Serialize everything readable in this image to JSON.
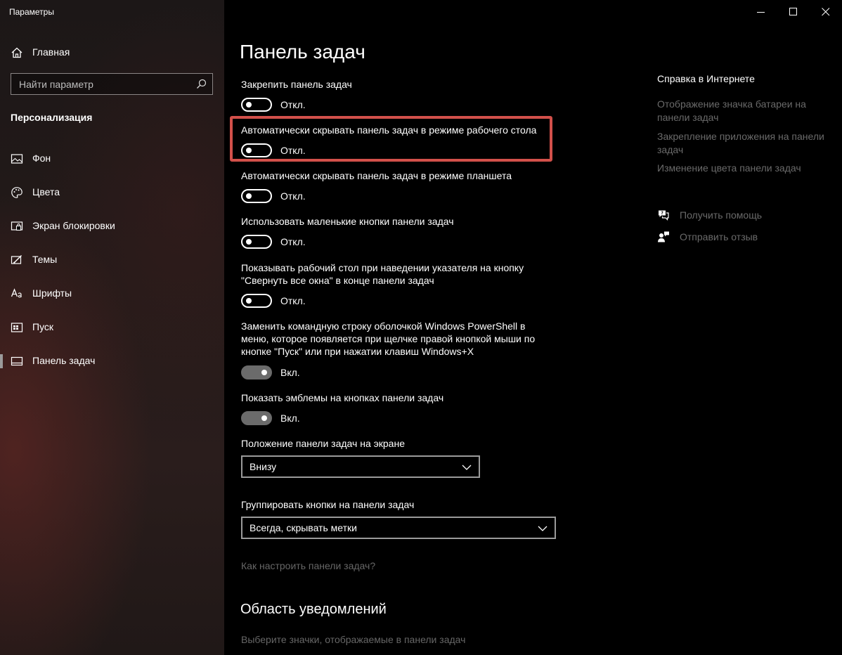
{
  "app": {
    "title": "Параметры"
  },
  "sidebar": {
    "home_label": "Главная",
    "search_placeholder": "Найти параметр",
    "section_title": "Персонализация",
    "items": [
      {
        "label": "Фон",
        "icon": "picture-icon"
      },
      {
        "label": "Цвета",
        "icon": "palette-icon"
      },
      {
        "label": "Экран блокировки",
        "icon": "lock-screen-icon"
      },
      {
        "label": "Темы",
        "icon": "themes-icon"
      },
      {
        "label": "Шрифты",
        "icon": "fonts-icon"
      },
      {
        "label": "Пуск",
        "icon": "start-icon"
      },
      {
        "label": "Панель задач",
        "icon": "taskbar-icon",
        "selected": true
      }
    ]
  },
  "main": {
    "title": "Панель задач",
    "settings": [
      {
        "label": "Закрепить панель задач",
        "state": "Откл.",
        "on": false
      },
      {
        "label": "Автоматически скрывать панель задач в режиме рабочего стола",
        "state": "Откл.",
        "on": false,
        "highlighted": true
      },
      {
        "label": "Автоматически скрывать панель задач в режиме планшета",
        "state": "Откл.",
        "on": false
      },
      {
        "label": "Использовать маленькие кнопки панели задач",
        "state": "Откл.",
        "on": false
      },
      {
        "label_lines": [
          "Показывать рабочий стол при наведении указателя на кнопку",
          "\"Свернуть все окна\" в конце панели задач"
        ],
        "state": "Откл.",
        "on": false
      },
      {
        "label_lines": [
          "Заменить командную строку оболочкой Windows PowerShell в",
          "меню, которое появляется при щелчке правой кнопкой мыши по",
          "кнопке \"Пуск\" или при нажатии клавиш Windows+X"
        ],
        "state": "Вкл.",
        "on": true
      },
      {
        "label": "Показать эмблемы на кнопках панели задач",
        "state": "Вкл.",
        "on": true
      }
    ],
    "position": {
      "label": "Положение панели задач на экране",
      "value": "Внизу"
    },
    "grouping": {
      "label": "Группировать кнопки на панели задач",
      "value": "Всегда, скрывать метки"
    },
    "how_to_link": "Как настроить панели задач?",
    "notifications_header": "Область уведомлений",
    "notifications_link": "Выберите значки, отображаемые в панели задач"
  },
  "help": {
    "title": "Справка в Интернете",
    "links": [
      [
        "Отображение значка батареи на",
        "панели задач"
      ],
      [
        "Закрепление приложения на панели",
        "задач"
      ],
      [
        "Изменение цвета панели задач"
      ]
    ],
    "get_help": "Получить помощь",
    "feedback": "Отправить отзыв"
  },
  "colors": {
    "highlight": "#d2504a",
    "toggle_on": "#6b6b6b",
    "muted_link": "#6a6a6a"
  }
}
